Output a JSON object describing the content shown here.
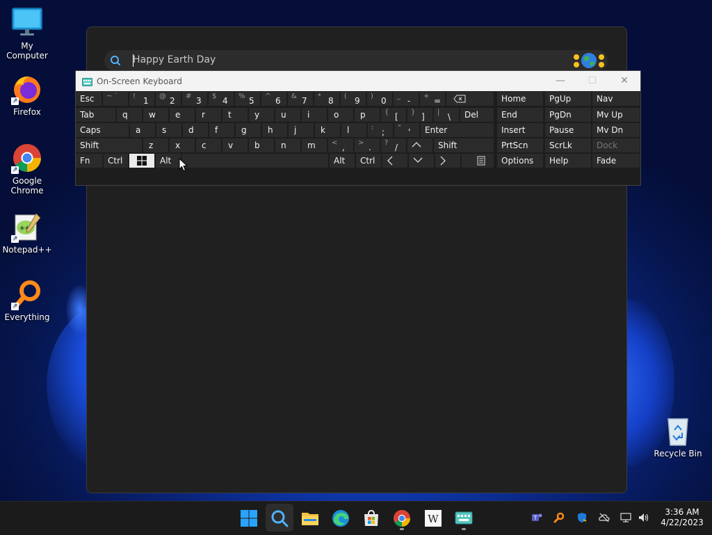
{
  "desktop": {
    "icons": [
      {
        "label": "My Computer"
      },
      {
        "label": "Firefox"
      },
      {
        "label": "Google Chrome"
      },
      {
        "label": "Notepad++"
      },
      {
        "label": "Everything"
      },
      {
        "label": "Recycle Bin"
      }
    ]
  },
  "search": {
    "placeholder": "Happy Earth Day"
  },
  "osk": {
    "title": "On-Screen Keyboard",
    "row1": {
      "esc": "Esc",
      "keys": [
        {
          "sub": "~ `",
          "main": ""
        },
        {
          "sub": "!",
          "main": "1"
        },
        {
          "sub": "@",
          "main": "2"
        },
        {
          "sub": "#",
          "main": "3"
        },
        {
          "sub": "$",
          "main": "4"
        },
        {
          "sub": "%",
          "main": "5"
        },
        {
          "sub": "^",
          "main": "6"
        },
        {
          "sub": "&",
          "main": "7"
        },
        {
          "sub": "*",
          "main": "8"
        },
        {
          "sub": "(",
          "main": "9"
        },
        {
          "sub": ")",
          "main": "0"
        },
        {
          "sub": "_",
          "main": "-"
        },
        {
          "sub": "+",
          "main": "="
        }
      ]
    },
    "row2": {
      "tab": "Tab",
      "letters": [
        "q",
        "w",
        "e",
        "r",
        "t",
        "y",
        "u",
        "i",
        "o",
        "p"
      ],
      "brackets": [
        {
          "sub": "{",
          "main": "["
        },
        {
          "sub": "}",
          "main": "]"
        },
        {
          "sub": "|",
          "main": "\\"
        }
      ],
      "del": "Del"
    },
    "row3": {
      "caps": "Caps",
      "letters": [
        "a",
        "s",
        "d",
        "f",
        "g",
        "h",
        "j",
        "k",
        "l"
      ],
      "punct": [
        {
          "sub": ":",
          "main": ";"
        },
        {
          "sub": "\"",
          "main": "'"
        }
      ],
      "enter": "Enter"
    },
    "row4": {
      "shift_left": "Shift",
      "letters": [
        "z",
        "x",
        "c",
        "v",
        "b",
        "n",
        "m"
      ],
      "punct": [
        {
          "sub": "<",
          "main": ","
        },
        {
          "sub": ">",
          "main": "."
        },
        {
          "sub": "?",
          "main": "/"
        }
      ],
      "shift_right": "Shift"
    },
    "row5": {
      "fn": "Fn",
      "ctrl_left": "Ctrl",
      "alt_left": "Alt",
      "alt_right": "Alt",
      "ctrl_right": "Ctrl"
    },
    "nav": [
      [
        "Home",
        "PgUp",
        "Nav"
      ],
      [
        "End",
        "PgDn",
        "Mv Up"
      ],
      [
        "Insert",
        "Pause",
        "Mv Dn"
      ],
      [
        "PrtScn",
        "ScrLk",
        "Dock"
      ],
      [
        "Options",
        "Help",
        "Fade"
      ]
    ]
  },
  "taskbar": {
    "clock": {
      "time": "3:36 AM",
      "date": "4/22/2023"
    }
  },
  "colors": {
    "accent": "#0a6cff",
    "panel": "#202020",
    "key": "#2b2b2b"
  }
}
